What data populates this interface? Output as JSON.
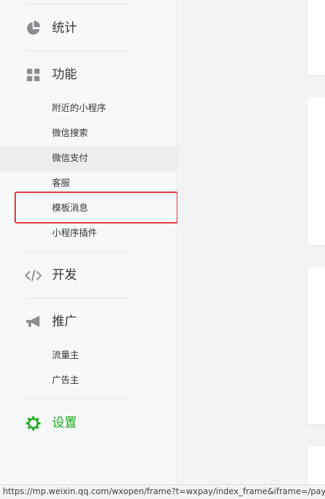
{
  "sidebar": {
    "sections": [
      {
        "label": "统计",
        "icon": "pie-chart-icon"
      },
      {
        "label": "功能",
        "icon": "grid-icon",
        "items": [
          "附近的小程序",
          "微信搜索",
          "微信支付",
          "客服",
          "模板消息",
          "小程序插件"
        ]
      },
      {
        "label": "开发",
        "icon": "code-icon"
      },
      {
        "label": "推广",
        "icon": "megaphone-icon",
        "items": [
          "流量主",
          "广告主"
        ]
      },
      {
        "label": "设置",
        "icon": "gear-icon"
      }
    ],
    "selected_item": "微信支付",
    "highlighted_item": "模板消息",
    "active_section": "设置"
  },
  "status_bar": {
    "url": "https://mp.weixin.qq.com/wxopen/frame?t=wxpay/index_frame&iframe=/pay/mp"
  },
  "colors": {
    "accent_green": "#1aad19",
    "icon_gray": "#8a8c91",
    "highlight_red": "#e5312f",
    "text": "#353535"
  }
}
